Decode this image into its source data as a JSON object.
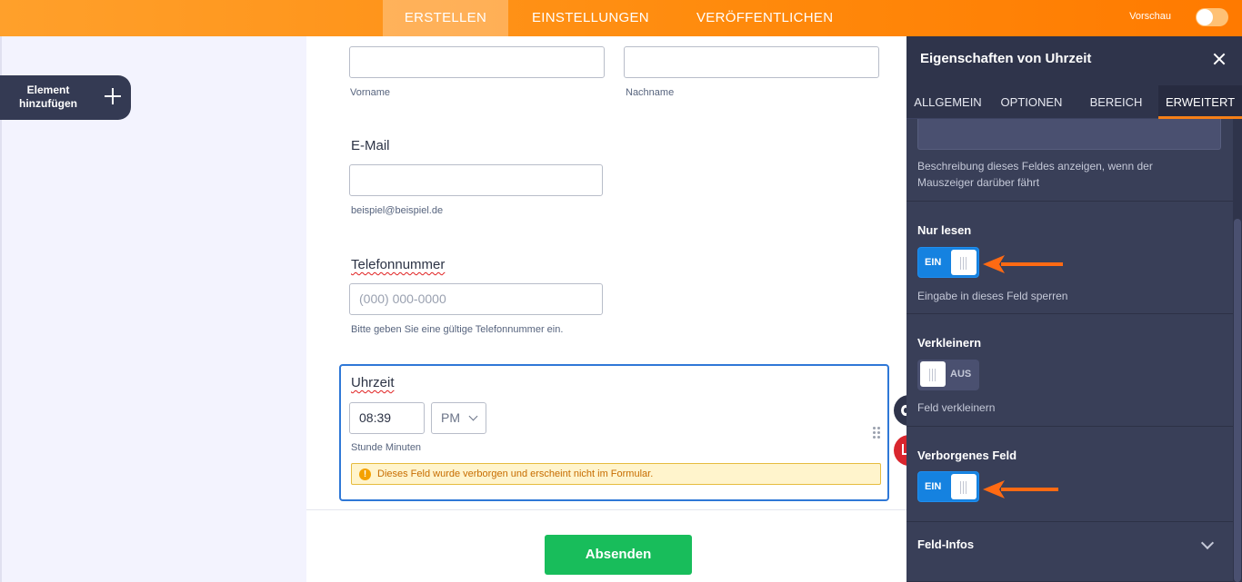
{
  "topbar": {
    "tabs": [
      {
        "label": "ERSTELLEN",
        "active": true
      },
      {
        "label": "EINSTELLUNGEN",
        "active": false
      },
      {
        "label": "VERÖFFENTLICHEN",
        "active": false
      }
    ],
    "preview_label": "Vorschau",
    "preview_on": false
  },
  "sidebar": {
    "add_element_line1": "Element",
    "add_element_line2": "hinzufügen"
  },
  "form": {
    "name": {
      "first_value": "",
      "last_value": "",
      "first_sublabel": "Vorname",
      "last_sublabel": "Nachname"
    },
    "email": {
      "label": "E-Mail",
      "value": "",
      "sublabel": "beispiel@beispiel.de"
    },
    "phone": {
      "label": "Telefonnummer",
      "placeholder": "(000) 000-0000",
      "sublabel": "Bitte geben Sie eine gültige Telefonnummer ein."
    },
    "time": {
      "label": "Uhrzeit",
      "value": "08:39",
      "ampm": "PM",
      "sublabel": "Stunde Minuten",
      "warning": "Dieses Feld wurde verborgen und erscheint nicht im Formular."
    },
    "submit_label": "Absenden"
  },
  "panel": {
    "title": "Eigenschaften von Uhrzeit",
    "tabs": [
      {
        "label": "ALLGEMEIN",
        "active": false
      },
      {
        "label": "OPTIONEN",
        "active": false
      },
      {
        "label": "BEREICH",
        "active": false
      },
      {
        "label": "ERWEITERT",
        "active": true
      }
    ],
    "hover_desc_line1": "Beschreibung dieses Feldes anzeigen, wenn der",
    "hover_desc_line2": "Mauszeiger darüber fährt",
    "readonly": {
      "label": "Nur lesen",
      "state": "EIN",
      "desc": "Eingabe in dieses Feld sperren"
    },
    "shrink": {
      "label": "Verkleinern",
      "state": "AUS",
      "desc": "Feld verkleinern"
    },
    "hidden": {
      "label": "Verborgenes Feld",
      "state": "EIN"
    },
    "field_info": {
      "label": "Feld-Infos"
    }
  },
  "colors": {
    "accent_orange": "#ff7a00",
    "toggle_on": "#1582e0",
    "submit_green": "#18bd5b",
    "panel_bg": "#393f58",
    "selection_blue": "#2f78d7"
  }
}
